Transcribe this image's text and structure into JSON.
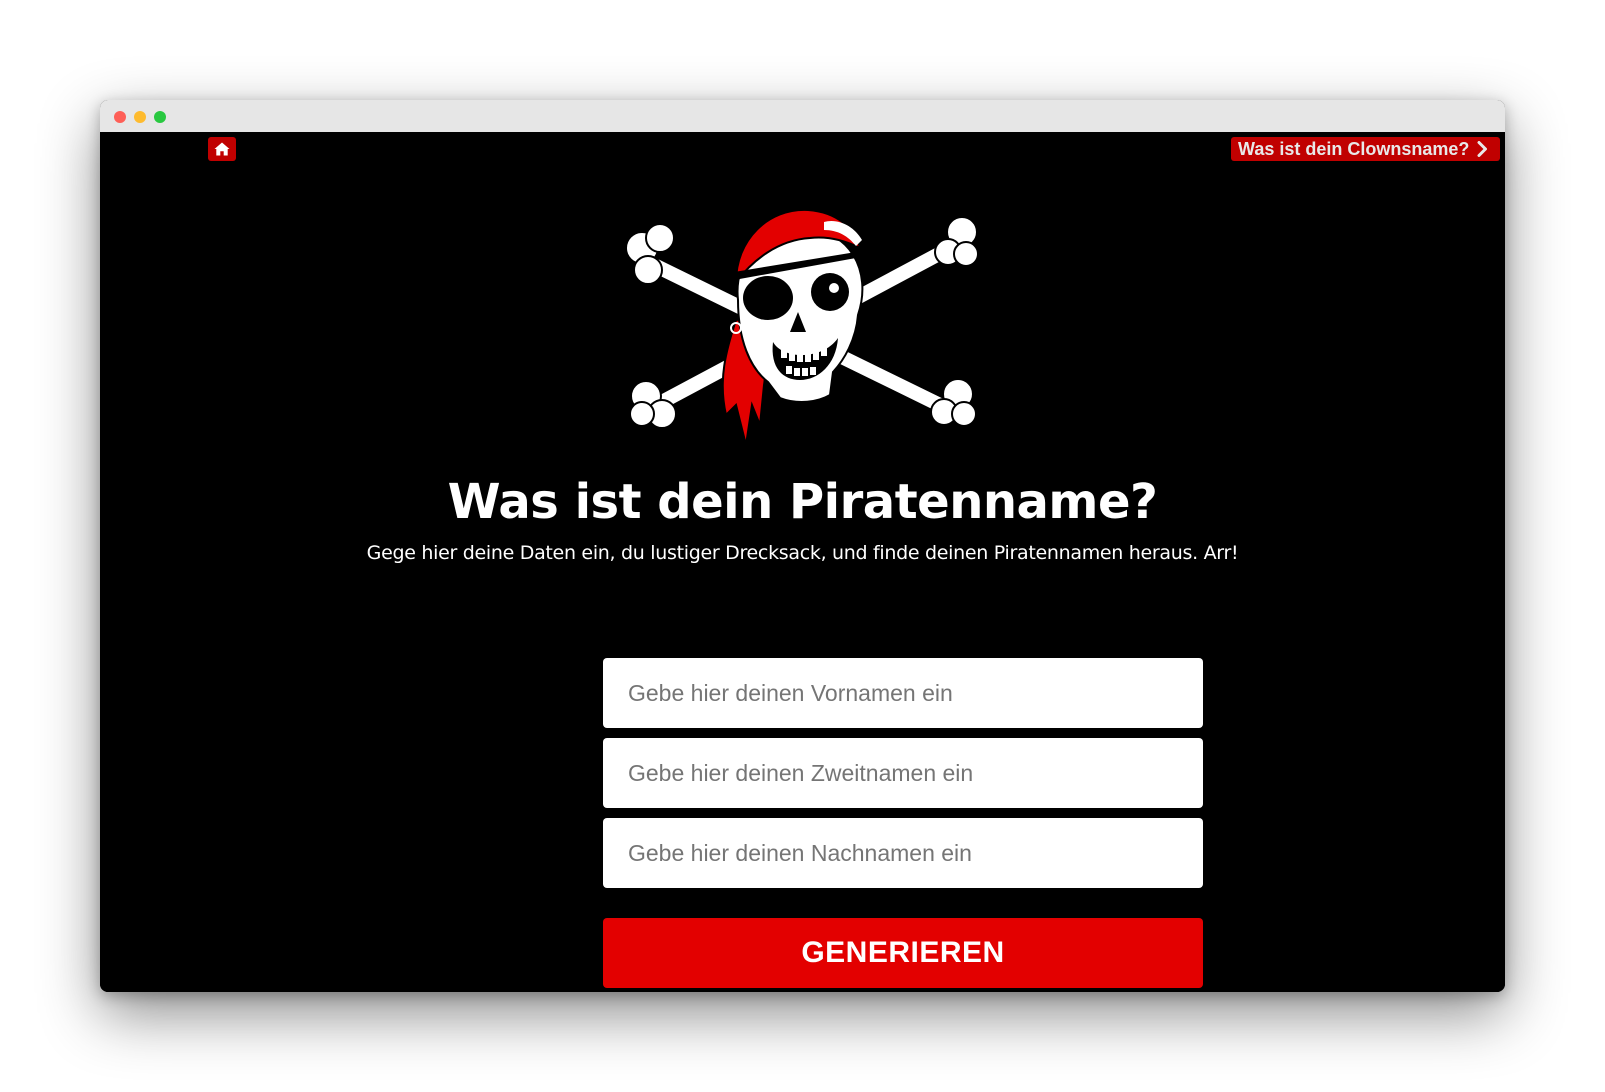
{
  "nav": {
    "home_icon": "home-icon",
    "clown_link_label": "Was ist dein Clownsname?",
    "clown_link_icon": "chevron-right-icon"
  },
  "hero": {
    "logo": "pirate-skull-crossbones-logo",
    "title": "Was ist dein Piratenname?",
    "subtitle": "Gege hier deine Daten ein, du lustiger Drecksack, und finde deinen Piratennamen heraus. Arr!"
  },
  "form": {
    "first_name_placeholder": "Gebe hier deinen Vornamen ein",
    "middle_name_placeholder": "Gebe hier deinen Zweitnamen ein",
    "last_name_placeholder": "Gebe hier deinen Nachnamen ein",
    "submit_label": "GENERIEREN"
  },
  "colors": {
    "background": "#000000",
    "accent": "#e30000",
    "nav_button": "#c00000"
  }
}
